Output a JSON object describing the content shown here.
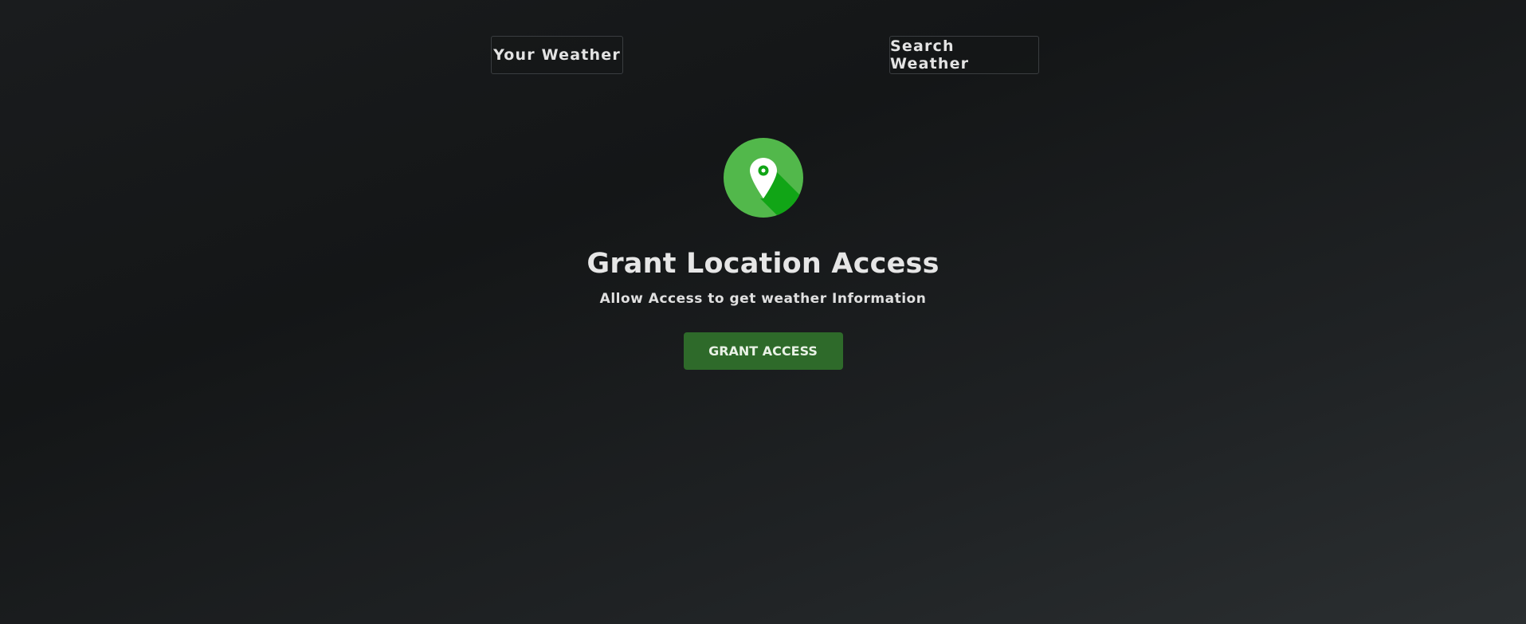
{
  "tabs": {
    "your_weather": "Your Weather",
    "search_weather": "Search Weather"
  },
  "grant_location": {
    "icon": "location-pin-icon",
    "title": "Grant Location Access",
    "subtitle": "Allow Access to get weather Information",
    "button_label": "GRANT ACCESS"
  },
  "colors": {
    "icon_circle": "#52b84b",
    "icon_shadow": "#11a516",
    "button_bg": "#2e6a2a"
  }
}
